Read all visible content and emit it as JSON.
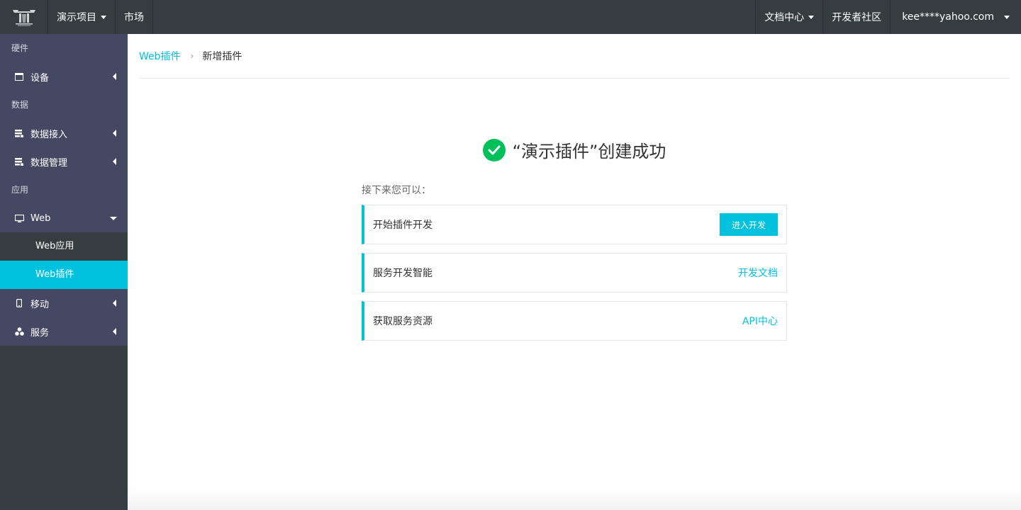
{
  "topbar": {
    "project": "演示项目",
    "market": "市场",
    "docs": "文档中心",
    "community": "开发者社区",
    "user": "kee****yahoo.com"
  },
  "sidebar": {
    "sections": {
      "hardware": "硬件",
      "data": "数据",
      "app": "应用"
    },
    "items": {
      "device": "设备",
      "data_access": "数据接入",
      "data_manage": "数据管理",
      "web": "Web",
      "mobile": "移动",
      "service": "服务"
    },
    "sub": {
      "web_app": "Web应用",
      "web_plugin": "Web插件"
    }
  },
  "breadcrumb": {
    "parent": "Web插件",
    "current": "新增插件"
  },
  "result": {
    "title": "“演示插件”创建成功",
    "next": "接下来您可以："
  },
  "tasks": [
    {
      "label": "开始插件开发",
      "action": "进入开发"
    },
    {
      "label": "服务开发智能",
      "action": "开发文档"
    },
    {
      "label": "获取服务资源",
      "action": "API中心"
    }
  ],
  "colors": {
    "accent": "#00c1de",
    "success": "#00c05a",
    "topbar": "#353d40",
    "menu": "#454862"
  }
}
